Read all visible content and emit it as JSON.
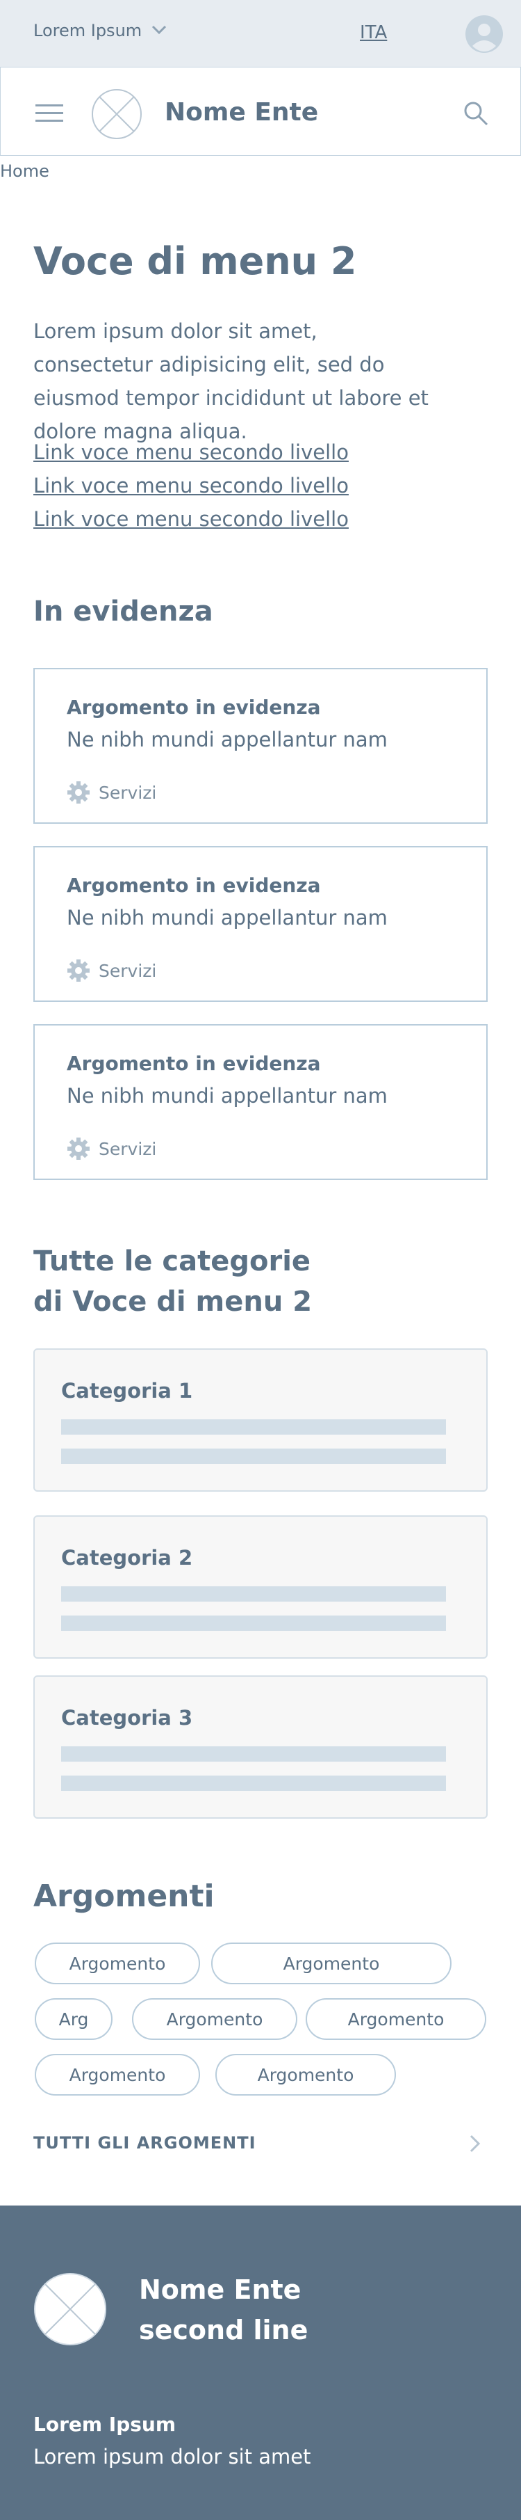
{
  "topbar": {
    "brand": "Lorem Ipsum",
    "language": "ITA"
  },
  "header": {
    "ente_name": "Nome Ente"
  },
  "breadcrumb": {
    "home": "Home"
  },
  "page": {
    "title": "Voce di menu 2",
    "intro": "Lorem ipsum dolor sit amet, consectetur adipisicing elit, sed do eiusmod tempor incididunt ut labore et dolore magna aliqua.",
    "links": [
      "Link voce menu secondo livello",
      "Link voce menu secondo livello",
      "Link voce menu secondo livello"
    ]
  },
  "highlights": {
    "title": "In evidenza",
    "cards": [
      {
        "title": "Argomento in evidenza",
        "text": "Ne nibh mundi appellantur nam",
        "category": "Servizi",
        "icon": "gear-icon"
      },
      {
        "title": "Argomento in evidenza",
        "text": "Ne nibh mundi appellantur nam",
        "category": "Servizi",
        "icon": "gear-icon"
      },
      {
        "title": "Argomento in evidenza",
        "text": "Ne nibh mundi appellantur nam",
        "category": "Servizi",
        "icon": "gear-icon"
      }
    ]
  },
  "categories": {
    "title_line1": "Tutte le categorie",
    "title_line2": "di Voce di menu 2",
    "items": [
      {
        "title": "Categoria 1"
      },
      {
        "title": "Categoria 2"
      },
      {
        "title": "Categoria 3"
      }
    ]
  },
  "topics": {
    "title": "Argomenti",
    "chips": [
      "Argomento",
      "Argomento",
      "Arg",
      "Argomento",
      "Argomento",
      "Argomento",
      "Argomento"
    ],
    "all_label": "TUTTI GLI ARGOMENTI"
  },
  "footer": {
    "name_line1": "Nome Ente",
    "name_line2": "second line",
    "heading": "Lorem Ipsum",
    "text": "Lorem ipsum dolor sit amet"
  },
  "colors": {
    "primary": "#5b7185",
    "topbar_bg": "#e7ecf1",
    "border": "#b9cddc",
    "placeholder": "#d3dfe8"
  }
}
